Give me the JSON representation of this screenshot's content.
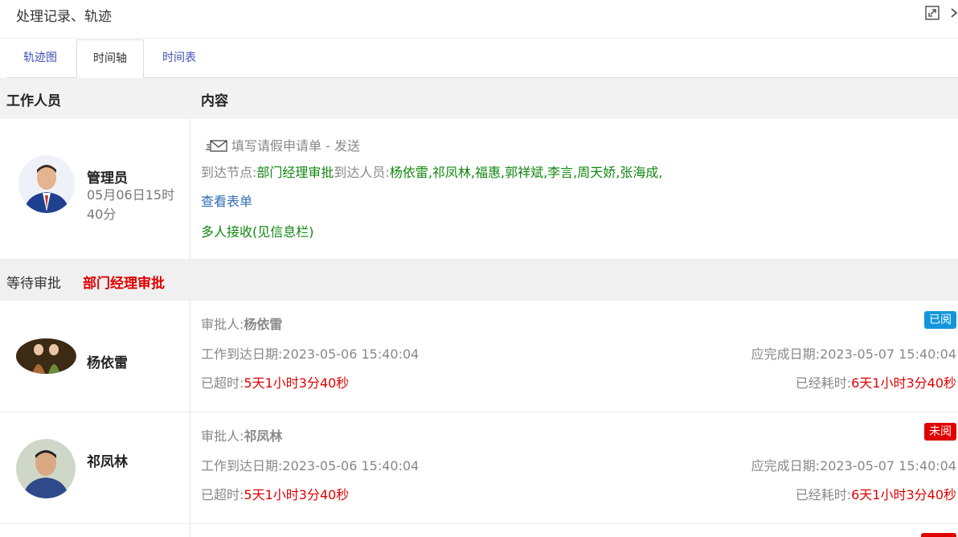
{
  "window": {
    "title": "处理记录、轨迹"
  },
  "tabs": [
    {
      "label": "轨迹图"
    },
    {
      "label": "时间轴"
    },
    {
      "label": "时间表"
    }
  ],
  "table": {
    "headers": {
      "worker": "工作人员",
      "content": "内容"
    }
  },
  "record1": {
    "name": "管理员",
    "time_line1": "05月06日15时",
    "time_line2": "40分",
    "action": "填写请假申请单 - 发送",
    "node_prefix": "到达节点:",
    "node_name": "部门经理审批",
    "people_prefix": "到达人员:",
    "people": "杨依雷,祁凤林,福惠,郭祥斌,李言,周天娇,张海成,",
    "view_form": "查看表单",
    "multi_receive": "多人接收(见信息栏)"
  },
  "waiting": {
    "label": "等待审批",
    "node": "部门经理审批"
  },
  "approvers": [
    {
      "name": "杨依雷",
      "approver_prefix": "审批人:",
      "approver": "杨依雷",
      "badge": "已阅",
      "arrive": "工作到达日期:2023-05-06 15:40:04",
      "due": "应完成日期:2023-05-07 15:40:04",
      "overdue_prefix": "已超时:",
      "overdue": "5天1小时3分40秒",
      "elapsed_prefix": "已经耗时:",
      "elapsed": "6天1小时3分40秒"
    },
    {
      "name": "祁凤林",
      "approver_prefix": "审批人:",
      "approver": "祁凤林",
      "badge": "未阅",
      "arrive": "工作到达日期:2023-05-06 15:40:04",
      "due": "应完成日期:2023-05-07 15:40:04",
      "overdue_prefix": "已超时:",
      "overdue": "5天1小时3分40秒",
      "elapsed_prefix": "已经耗时:",
      "elapsed": "6天1小时3分40秒"
    }
  ],
  "colors": {
    "read_badge": "#1296db",
    "unread_badge": "#e00000",
    "tab_link": "#3f51b5",
    "green": "#118811",
    "red": "#e00000"
  }
}
